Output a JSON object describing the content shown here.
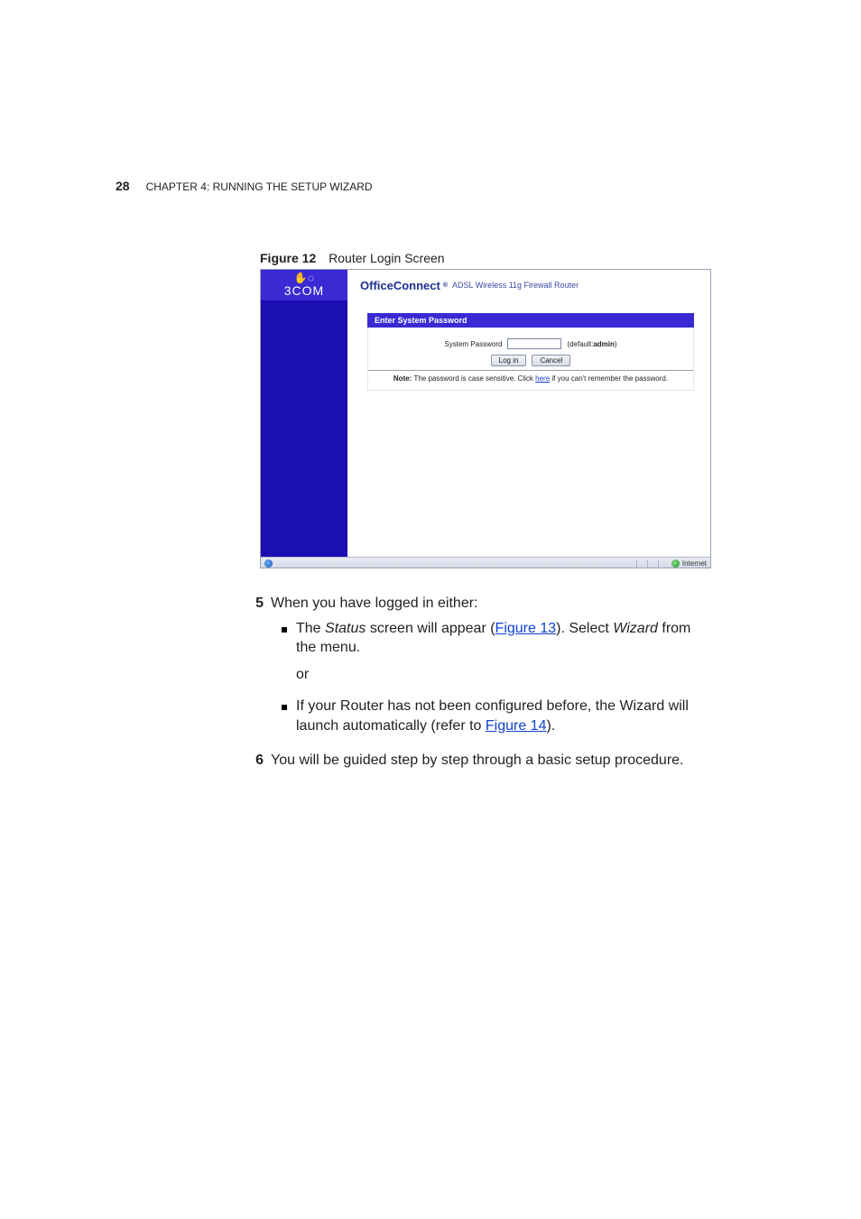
{
  "page": {
    "number": "28",
    "chapter_prefix": "C",
    "chapter_word": "HAPTER",
    "chapter_num": " 4: ",
    "chapter_title_first": "R",
    "chapter_title_rest": "UNNING THE ",
    "chapter_title_first2": "S",
    "chapter_title_rest2": "ETUP ",
    "chapter_title_first3": "W",
    "chapter_title_rest3": "IZARD"
  },
  "figure": {
    "label": "Figure 12",
    "caption": "Router Login Screen"
  },
  "screenshot": {
    "logo_text": "3COM",
    "brand": "OfficeConnect",
    "brand_suffix": "®",
    "product": " ADSL Wireless 11g Firewall Router",
    "panel_title": "Enter System Password",
    "password_label": "System Password",
    "default_prefix": "(default:",
    "default_value": "admin",
    "default_suffix": ")",
    "btn_login": "Log in",
    "btn_cancel": "Cancel",
    "note_bold": "Note:",
    "note_text_a": " The password is case sensitive. Click ",
    "note_link": "here",
    "note_text_b": " if you can't remember the password.",
    "status_zone": "Internet"
  },
  "steps": {
    "n5": "5",
    "n5_intro": "When you have logged in either:",
    "b1_a": "The ",
    "b1_status": "Status",
    "b1_b": " screen will appear (",
    "b1_link": "Figure 13",
    "b1_c": "). Select ",
    "b1_wizard": "Wizard",
    "b1_d": " from the menu.",
    "or": "or",
    "b2_a": "If your Router has not been configured before, the Wizard will launch automatically (refer to ",
    "b2_link": "Figure 14",
    "b2_b": ").",
    "n6": "6",
    "n6_text": "You will be guided step by step through a basic setup procedure."
  }
}
